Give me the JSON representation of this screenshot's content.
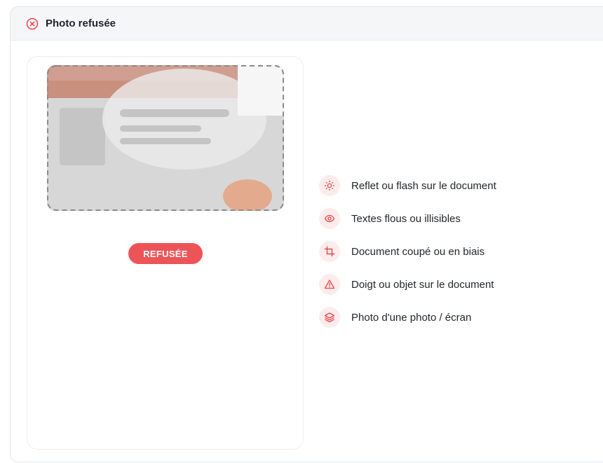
{
  "header": {
    "title": "Photo refusée",
    "icon": "circle-x-icon"
  },
  "card": {
    "badge_label": "REFUSÉE",
    "badge_color": "#ec5458"
  },
  "reasons": [
    {
      "label": "Reflet ou flash sur le document",
      "icon": "sun-glare-icon"
    },
    {
      "label": "Textes flous ou illisibles",
      "icon": "eye-icon"
    },
    {
      "label": "Document coupé ou en biais",
      "icon": "crop-icon"
    },
    {
      "label": "Doigt ou objet sur le document",
      "icon": "warning-triangle-icon"
    },
    {
      "label": "Photo d'une photo / écran",
      "icon": "layers-icon"
    }
  ],
  "colors": {
    "accent": "#ec5458",
    "icon_bg": "#fdeceb",
    "text": "#23262b"
  }
}
